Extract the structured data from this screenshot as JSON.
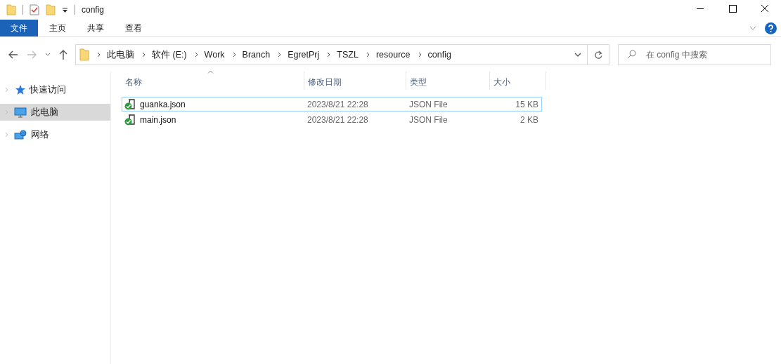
{
  "window": {
    "title": "config"
  },
  "ribbon_tabs": [
    {
      "label": "文件",
      "kind": "file"
    },
    {
      "label": "主页",
      "kind": "tab"
    },
    {
      "label": "共享",
      "kind": "tab"
    },
    {
      "label": "查看",
      "kind": "tab"
    }
  ],
  "address_bar": {
    "segments": [
      "此电脑",
      "软件 (E:)",
      "Work",
      "Branch",
      "EgretPrj",
      "TSZL",
      "resource",
      "config"
    ]
  },
  "search": {
    "placeholder": "在 config 中搜索"
  },
  "sidebar": {
    "items": [
      {
        "label": "快速访问",
        "kind": "star",
        "selected": false
      },
      {
        "label": "此电脑",
        "kind": "computer",
        "selected": true
      },
      {
        "label": "网络",
        "kind": "network",
        "selected": false
      }
    ]
  },
  "table": {
    "columns": [
      {
        "label": "名称",
        "sorted": true
      },
      {
        "label": "修改日期",
        "sorted": false
      },
      {
        "label": "类型",
        "sorted": false
      },
      {
        "label": "大小",
        "sorted": false
      }
    ],
    "rows": [
      {
        "name": "guanka.json",
        "modified": "2023/8/21 22:28",
        "type": "JSON File",
        "size": "15 KB",
        "focused": true
      },
      {
        "name": "main.json",
        "modified": "2023/8/21 22:28",
        "type": "JSON File",
        "size": "2 KB",
        "focused": false
      }
    ]
  }
}
